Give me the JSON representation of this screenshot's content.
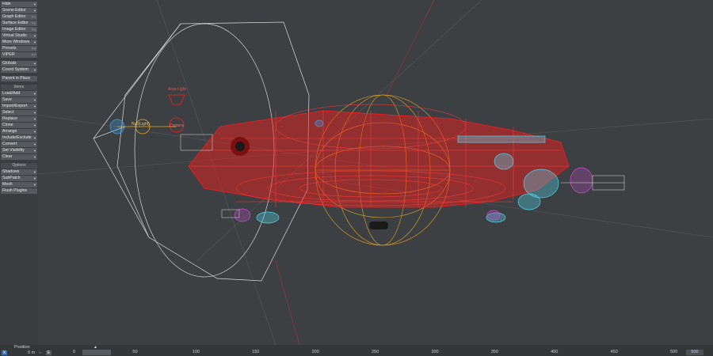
{
  "sidebar": {
    "items": [
      {
        "label": "Hide",
        "arrow": "▾"
      },
      {
        "label": "Scene Editor",
        "arrow": "▾"
      },
      {
        "label": "Graph Editor",
        "key": "F2"
      },
      {
        "label": "Surface Editor",
        "key": "F5"
      },
      {
        "label": "Image Editor",
        "key": "F6"
      },
      {
        "label": "Virtual Studio",
        "arrow": "▾"
      },
      {
        "label": "More Windows",
        "arrow": "▾"
      },
      {
        "label": "Presets",
        "key": "F8"
      },
      {
        "label": "VIPER",
        "key": "F7"
      },
      {
        "label": "Globals",
        "arrow": "▾"
      },
      {
        "label": "Coord System",
        "arrow": "▾"
      },
      {
        "label": "Parent in Place"
      }
    ],
    "items_section": {
      "header": "Items",
      "items": [
        {
          "label": "Load/Add",
          "arrow": "▾"
        },
        {
          "label": "Save",
          "arrow": "▾"
        },
        {
          "label": "Import/Export",
          "arrow": "▾"
        },
        {
          "label": "Select",
          "arrow": "▾"
        },
        {
          "label": "Replace",
          "arrow": "▾"
        },
        {
          "label": "Clone",
          "arrow": "▾"
        },
        {
          "label": "Arrange",
          "arrow": "▾"
        },
        {
          "label": "Include/Exclude",
          "arrow": "▾"
        },
        {
          "label": "Convert",
          "arrow": "▾"
        },
        {
          "label": "Set Visibility",
          "arrow": "▾"
        },
        {
          "label": "Clear",
          "arrow": "▾"
        }
      ]
    },
    "options_section": {
      "header": "Options",
      "items": [
        {
          "label": "Shadows",
          "arrow": "▾"
        },
        {
          "label": "SubPatch",
          "arrow": "▾"
        },
        {
          "label": "Mesh",
          "arrow": "▾"
        },
        {
          "label": "Flush Plugins"
        }
      ]
    }
  },
  "viewport": {
    "labels": {
      "null_label": "Null(Light)",
      "light_label": "Area Light",
      "camera_label": "Camera"
    }
  },
  "timeline": {
    "position_label": "Position",
    "x_label": "X",
    "x_value": "0 m",
    "e_label": "E",
    "current_frame": "0",
    "end_frame": "500",
    "ticks": [
      "0",
      "50",
      "100",
      "150",
      "200",
      "250",
      "300",
      "350",
      "400",
      "450",
      "500"
    ]
  },
  "colors": {
    "background": "#3d4043",
    "wire_red": "#ff1a1a",
    "wire_gold": "#e8a81a",
    "wire_cyan": "#4fd6ea",
    "wire_magenta": "#d04ad8",
    "wire_white": "#d8d8d8"
  }
}
